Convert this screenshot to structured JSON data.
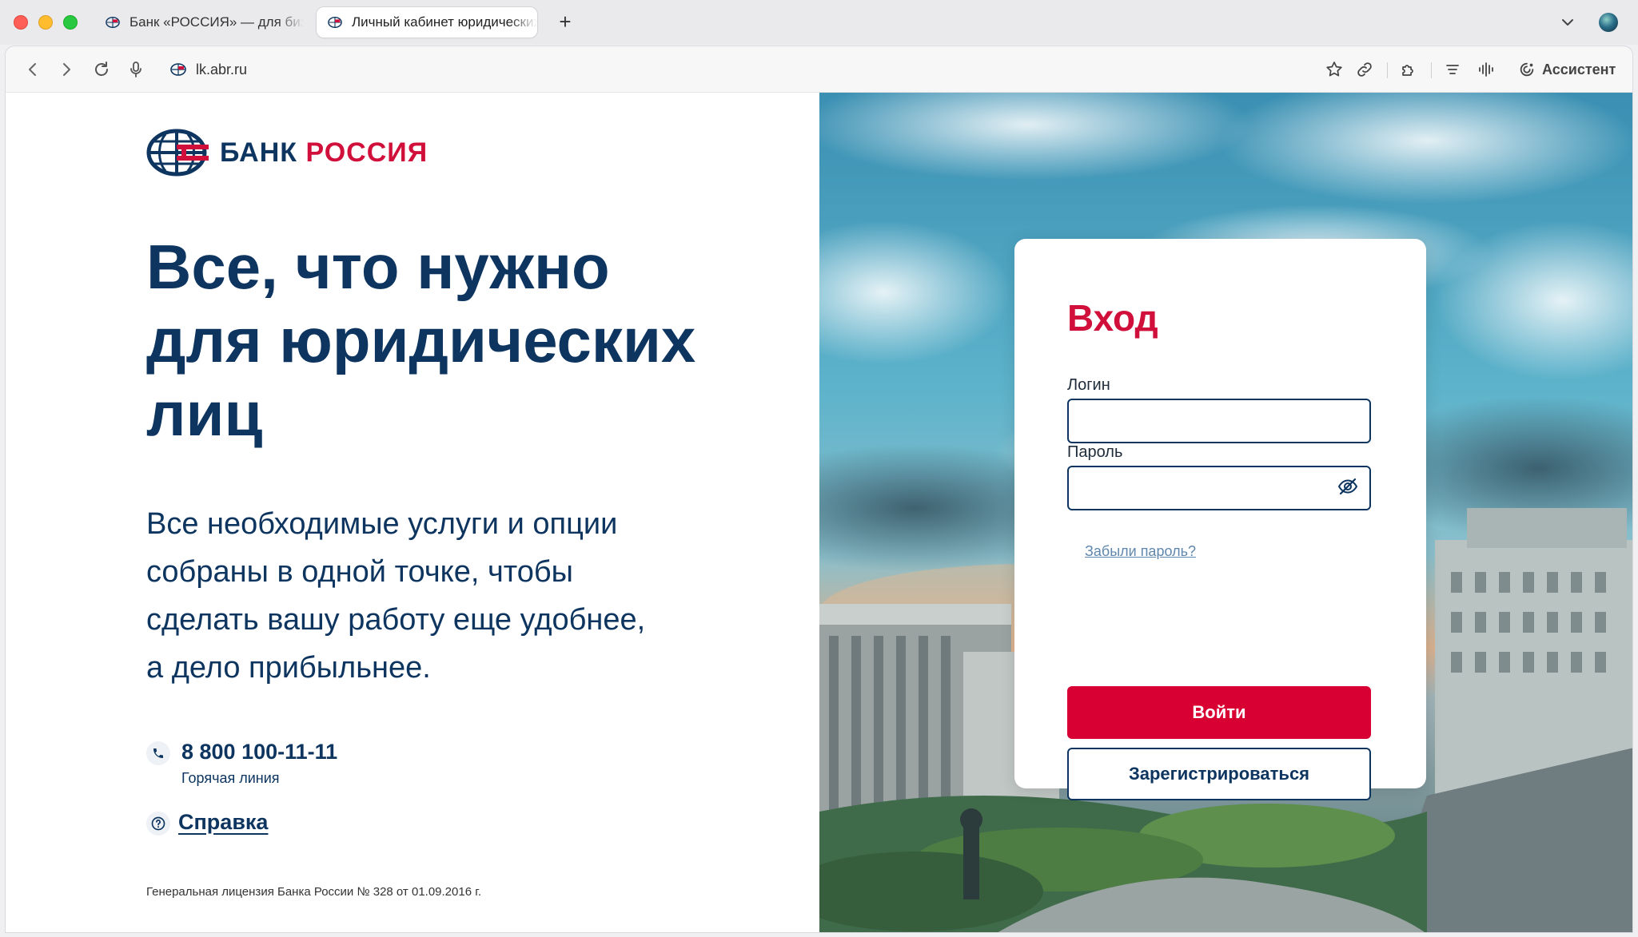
{
  "browser": {
    "tabs": [
      {
        "label": "Банк «РОССИЯ» — для бизнеса",
        "active": false
      },
      {
        "label": "Личный кабинет юридических лиц",
        "active": true
      }
    ],
    "new_tab_label": "+",
    "url": "lk.abr.ru",
    "assistant_label": "Ассистент"
  },
  "brand": {
    "name_part1": "БАНК",
    "name_part2": "РОССИЯ",
    "color_primary": "#0d3560",
    "color_accent": "#d0103a"
  },
  "hero": {
    "headline_line1": "Все, что нужно",
    "headline_line2": "для юридических",
    "headline_line3": "лиц",
    "lead_line1": "Все необходимые услуги и опции",
    "lead_line2": "собраны в одной точке, чтобы",
    "lead_line3": "сделать вашу работу еще удобнее,",
    "lead_line4": "а дело прибыльнее."
  },
  "contacts": {
    "phone": "8 800 100-11-11",
    "phone_caption": "Горячая линия",
    "help_link": "Справка"
  },
  "footer": {
    "license": "Генеральная лицензия Банка России № 328 от 01.09.2016 г."
  },
  "login": {
    "title": "Вход",
    "login_label": "Логин",
    "login_value": "",
    "password_label": "Пароль",
    "password_value": "",
    "forgot_link": "Забыли пароль?",
    "submit_label": "Войти",
    "register_label": "Зарегистрироваться"
  },
  "icons": [
    "back-icon",
    "forward-icon",
    "reload-icon",
    "microphone-icon",
    "bookmark-star-icon",
    "link-icon",
    "extensions-icon",
    "reader-icon",
    "voice-icon",
    "assistant-icon",
    "phone-icon",
    "help-icon",
    "eye-hidden-icon"
  ]
}
